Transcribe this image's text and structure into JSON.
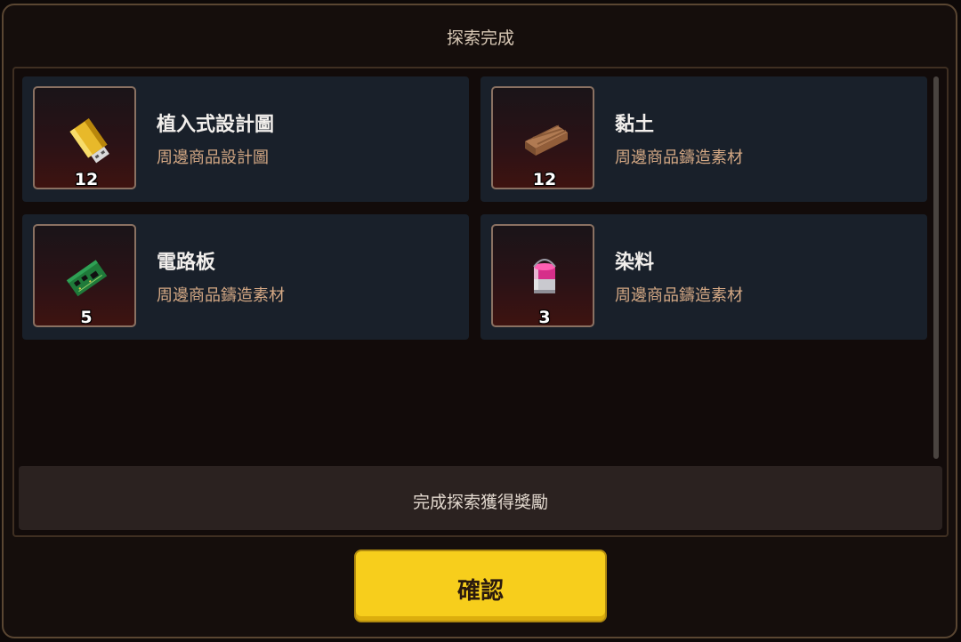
{
  "header": {
    "title": "探索完成"
  },
  "items": [
    {
      "name": "植入式設計圖",
      "category": "周邊商品設計圖",
      "quantity": "12",
      "icon": "usb-drive-icon"
    },
    {
      "name": "黏土",
      "category": "周邊商品鑄造素材",
      "quantity": "12",
      "icon": "clay-planks-icon"
    },
    {
      "name": "電路板",
      "category": "周邊商品鑄造素材",
      "quantity": "5",
      "icon": "circuit-board-icon"
    },
    {
      "name": "染料",
      "category": "周邊商品鑄造素材",
      "quantity": "3",
      "icon": "paint-bucket-icon"
    }
  ],
  "reward_bar": {
    "text": "完成探索獲得獎勵"
  },
  "confirm_button": {
    "label": "確認"
  },
  "colors": {
    "accent": "#f7ce1c",
    "card_bg": "#19202a",
    "category_text": "#d4a884"
  }
}
